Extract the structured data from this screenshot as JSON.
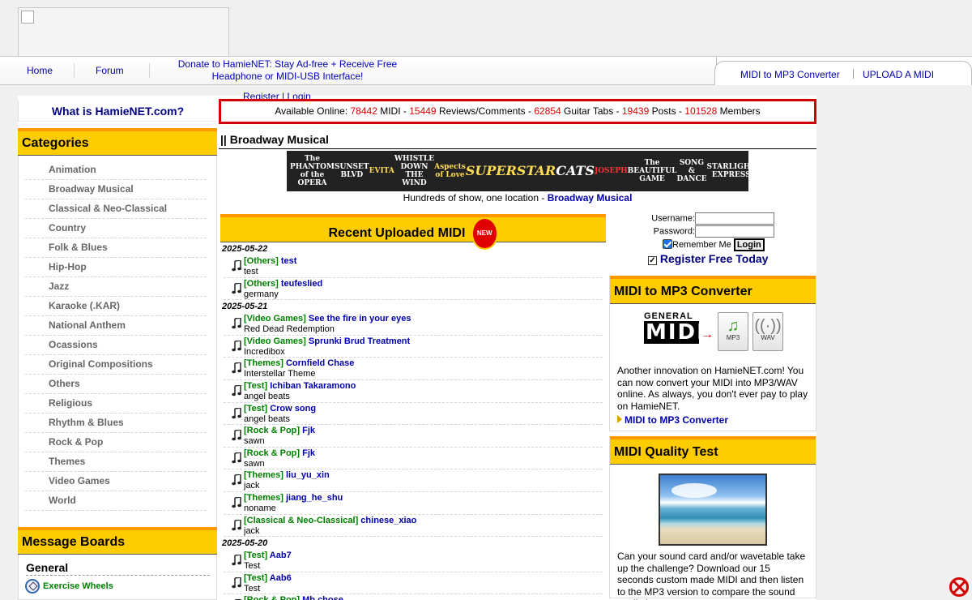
{
  "nav": {
    "home": "Home",
    "forum": "Forum",
    "donate_line1": "Donate to HamieNET: Stay Ad-free + Receive Free",
    "donate_line2": "Headphone or MIDI-USB Interface!",
    "converter": "MIDI to MP3 Converter",
    "upload": "UPLOAD A MIDI",
    "register": "Register",
    "login": "Login"
  },
  "what_is": "What is HamieNET.com?",
  "stats": {
    "label": "Available Online:",
    "midi_count": "78442",
    "midi_label": "MIDI -",
    "reviews_count": "15449",
    "reviews_label": "Reviews/Comments -",
    "tabs_count": "62854",
    "tabs_label": "Guitar Tabs -",
    "posts_count": "19439",
    "posts_label": "Posts -",
    "members_count": "101528",
    "members_label": "Members"
  },
  "categories": {
    "title": "Categories",
    "items": [
      "Animation",
      "Broadway Musical",
      "Classical & Neo-Classical",
      "Country",
      "Folk & Blues",
      "Hip-Hop",
      "Jazz",
      "Karaoke (.KAR)",
      "National Anthem",
      "Ocassions",
      "Original Compositions",
      "Others",
      "Religious",
      "Rhythm & Blues",
      "Rock & Pop",
      "Themes",
      "Video Games",
      "World"
    ]
  },
  "message_boards": {
    "title": "Message Boards",
    "general": "General",
    "item": "Exercise Wheels"
  },
  "section_title": "|| Broadway Musical",
  "banner": {
    "shows": [
      "The PHANTOM of the OPERA",
      "SUNSET BLVD",
      "EVITA",
      "WHISTLE DOWN THE WIND",
      "Aspects of Love",
      "SUPERSTAR",
      "CATS",
      "JOSEPH",
      "The BEAUTIFUL GAME",
      "SONG & DANCE",
      "STARLIGHT EXPRESS"
    ],
    "caption": "Hundreds of show, one location -",
    "caption_link": "Broadway Musical"
  },
  "recent": {
    "title": "Recent Uploaded MIDI",
    "badge": "NEW",
    "groups": [
      {
        "date": "2025-05-22",
        "entries": [
          {
            "cat": "[Others]",
            "title": "test",
            "user": "test"
          },
          {
            "cat": "[Others]",
            "title": "teufeslied",
            "user": "germany"
          }
        ]
      },
      {
        "date": "2025-05-21",
        "entries": [
          {
            "cat": "[Video Games]",
            "title": "See the fire in your eyes",
            "user": "Red Dead Redemption"
          },
          {
            "cat": "[Video Games]",
            "title": "Sprunki Brud Treatment",
            "user": "Incredibox"
          },
          {
            "cat": "[Themes]",
            "title": "Cornfield Chase",
            "user": "Interstellar Theme"
          },
          {
            "cat": "[Test]",
            "title": "Ichiban Takaramono",
            "user": "angel beats"
          },
          {
            "cat": "[Test]",
            "title": "Crow song",
            "user": "angel beats"
          },
          {
            "cat": "[Rock & Pop]",
            "title": "Fjk",
            "user": "sawn"
          },
          {
            "cat": "[Rock & Pop]",
            "title": "Fjk",
            "user": "sawn"
          },
          {
            "cat": "[Themes]",
            "title": "liu_yu_xin",
            "user": "jack"
          },
          {
            "cat": "[Themes]",
            "title": "jiang_he_shu",
            "user": "noname"
          },
          {
            "cat": "[Classical & Neo-Classical]",
            "title": "chinese_xiao",
            "user": "jack"
          }
        ]
      },
      {
        "date": "2025-05-20",
        "entries": [
          {
            "cat": "[Test]",
            "title": "Aab7",
            "user": "Test"
          },
          {
            "cat": "[Test]",
            "title": "Aab6",
            "user": "Test"
          },
          {
            "cat": "[Rock & Pop]",
            "title": "Mb chose",
            "user": ""
          }
        ]
      }
    ]
  },
  "login": {
    "username_label": "Username:",
    "password_label": "Password:",
    "remember": "Remember Me",
    "button": "Login",
    "register_free": "Register Free Today"
  },
  "converter_panel": {
    "title": "MIDI to MP3 Converter",
    "logo_top": "GENERAL",
    "logo_main": "MIDI",
    "mp3": "MP3",
    "wav": "WAV",
    "text": "Another innovation on HamieNET.com! You can now convert your MIDI into MP3/WAV online. As always, you don't ever pay to play on HamieNET.",
    "link": "MIDI to MP3 Converter"
  },
  "quality_panel": {
    "title": "MIDI Quality Test",
    "text": "Can your sound card and/or wavetable take up the challenge? Download our 15 seconds custom made MIDI and then listen to the MP3 version to compare the sound quality!"
  },
  "colors": {
    "accent_yellow": "#ffcc00",
    "accent_orange": "#ff9900",
    "link_blue": "#0000aa",
    "stat_red": "#d40000",
    "category_green": "#008000"
  }
}
